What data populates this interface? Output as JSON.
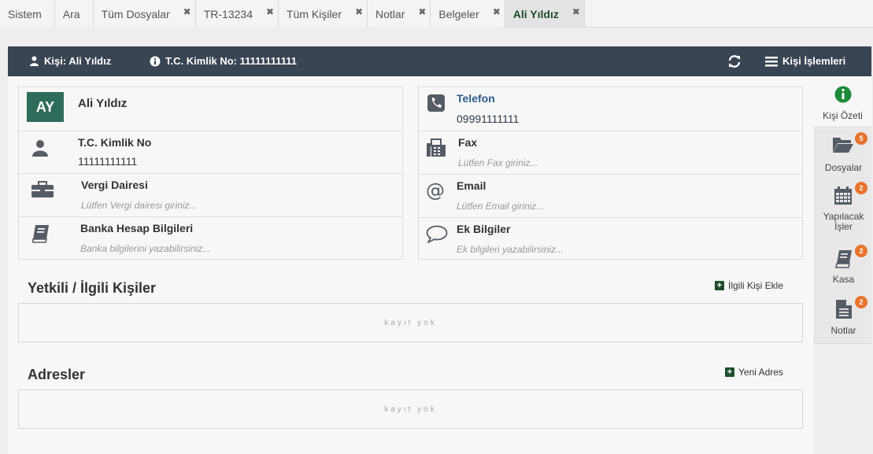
{
  "tabs": [
    {
      "label": "Sistem",
      "closable": false
    },
    {
      "label": "Ara",
      "closable": false
    },
    {
      "label": "Tüm Dosyalar",
      "closable": true
    },
    {
      "label": "TR-13234",
      "closable": true
    },
    {
      "label": "Tüm Kişiler",
      "closable": true
    },
    {
      "label": "Notlar",
      "closable": true
    },
    {
      "label": "Belgeler",
      "closable": true
    },
    {
      "label": "Ali Yıldız",
      "closable": true,
      "active": true
    }
  ],
  "tab_close_glyph": "✖",
  "header": {
    "person_label": "Kişi: Ali Yıldız",
    "tc_label": "T.C. Kimlik No: 11111111111",
    "ops_label": "Kişi İşlemleri"
  },
  "left_card": {
    "avatar_initials": "AY",
    "name": "Ali Yıldız",
    "tc": {
      "label": "T.C. Kimlik No",
      "value": "11111111111"
    },
    "tax": {
      "label": "Vergi Dairesi",
      "placeholder": "Lütfen Vergi dairesi giriniz..."
    },
    "bank": {
      "label": "Banka Hesap Bilgileri",
      "placeholder": "Banka bilgilerini yazabilirsiniz..."
    }
  },
  "right_card": {
    "phone": {
      "label": "Telefon",
      "value": "09991111111"
    },
    "fax": {
      "label": "Fax",
      "placeholder": "Lütfen Fax giriniz..."
    },
    "email": {
      "label": "Email",
      "placeholder": "Lütfen Email giriniz..."
    },
    "extra": {
      "label": "Ek Bilgiler",
      "placeholder": "Ek bilgileri yazabilirsiniz..."
    }
  },
  "sections": {
    "related": {
      "title": "Yetkili / İlgili Kişiler",
      "action": "İlgili Kişi Ekle",
      "empty": "kayıt yok"
    },
    "addresses": {
      "title": "Adresler",
      "action": "Yeni Adres",
      "empty": "kayıt yok"
    }
  },
  "sidebar": {
    "summary": {
      "label": "Kişi Özeti"
    },
    "files": {
      "label": "Dosyalar",
      "badge": "5"
    },
    "todos": {
      "label_line1": "Yapılacak",
      "label_line2": "İşler",
      "badge": "2"
    },
    "cash": {
      "label": "Kasa",
      "badge": "2"
    },
    "notes": {
      "label": "Notlar",
      "badge": "2"
    }
  },
  "colors": {
    "header_bg": "#3a4553",
    "accent_green": "#1e4d2b",
    "badge": "#e8742c",
    "link_blue": "#2a5c8a"
  }
}
